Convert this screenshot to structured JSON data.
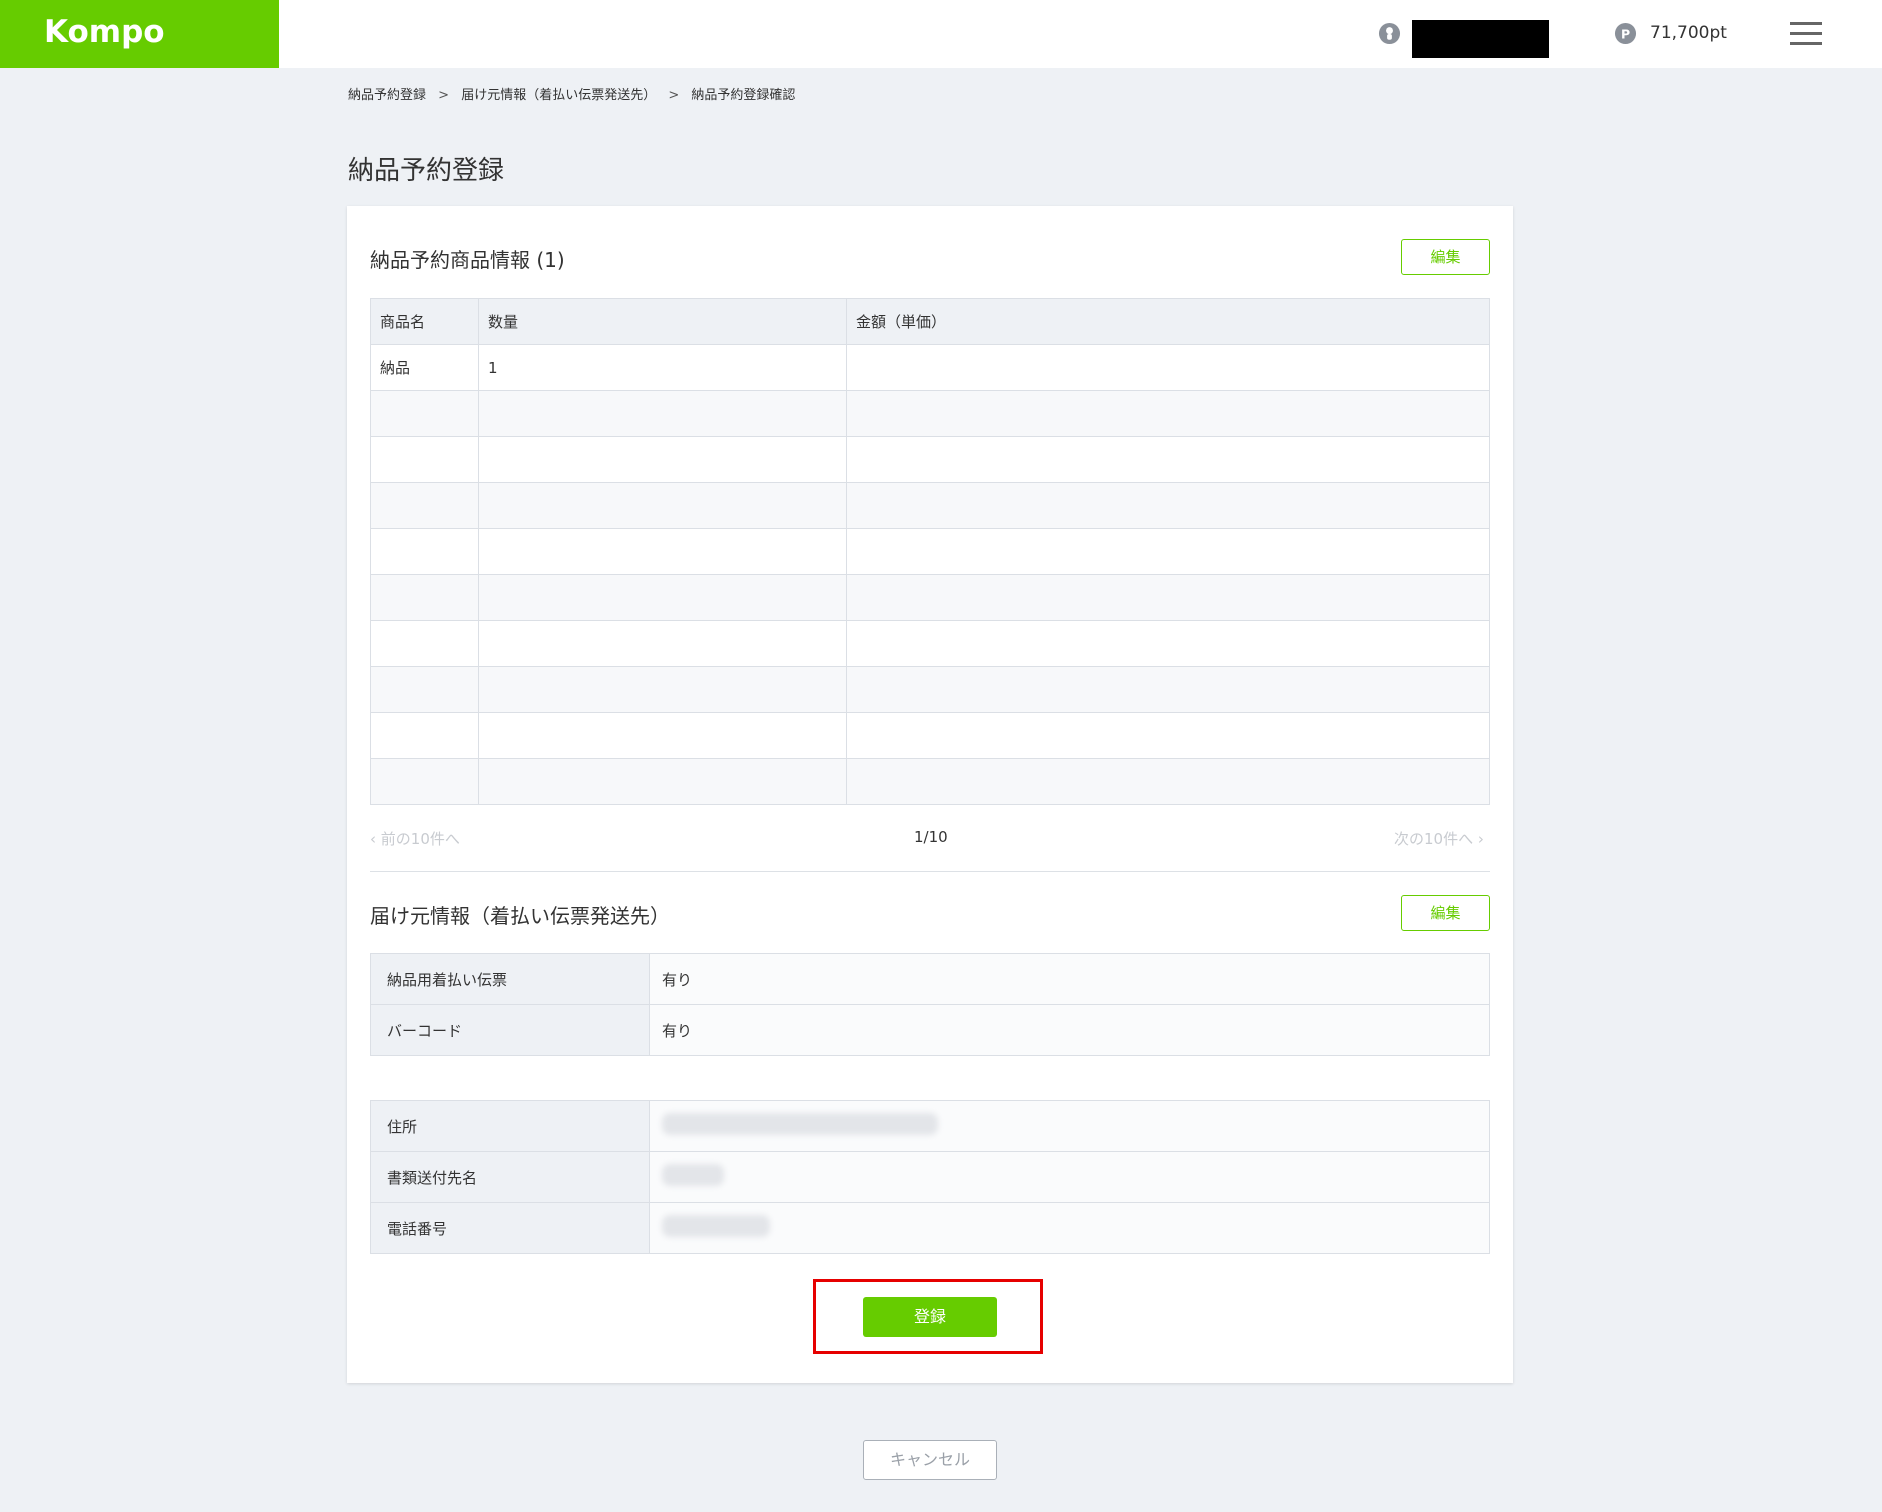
{
  "header": {
    "logo": "Kompo",
    "points": "71,700pt"
  },
  "breadcrumb": {
    "items": [
      "納品予約登録",
      "届け元情報（着払い伝票発送先）",
      "納品予約登録確認"
    ],
    "separator": ">"
  },
  "page": {
    "title": "納品予約登録"
  },
  "items_section": {
    "title": "納品予約商品情報 (1)",
    "edit_label": "編集",
    "columns": [
      "商品名",
      "数量",
      "金額（単価）"
    ],
    "rows": [
      [
        "納品",
        "1",
        ""
      ],
      [
        "",
        "",
        ""
      ],
      [
        "",
        "",
        ""
      ],
      [
        "",
        "",
        ""
      ],
      [
        "",
        "",
        ""
      ],
      [
        "",
        "",
        ""
      ],
      [
        "",
        "",
        ""
      ],
      [
        "",
        "",
        ""
      ],
      [
        "",
        "",
        ""
      ],
      [
        "",
        "",
        ""
      ]
    ],
    "pager": {
      "prev": "前の10件へ",
      "page": "1/10",
      "next": "次の10件へ"
    }
  },
  "sender_section": {
    "title": "届け元情報（着払い伝票発送先）",
    "edit_label": "編集",
    "slip": [
      {
        "label": "納品用着払い伝票",
        "value": "有り"
      },
      {
        "label": "バーコード",
        "value": "有り"
      }
    ],
    "address": [
      {
        "label": "住所"
      },
      {
        "label": "書類送付先名"
      },
      {
        "label": "電話番号"
      }
    ]
  },
  "actions": {
    "register_label": "登録",
    "cancel_label": "キャンセル"
  },
  "colors": {
    "brand": "#66cc00",
    "highlight": "#e60000"
  }
}
